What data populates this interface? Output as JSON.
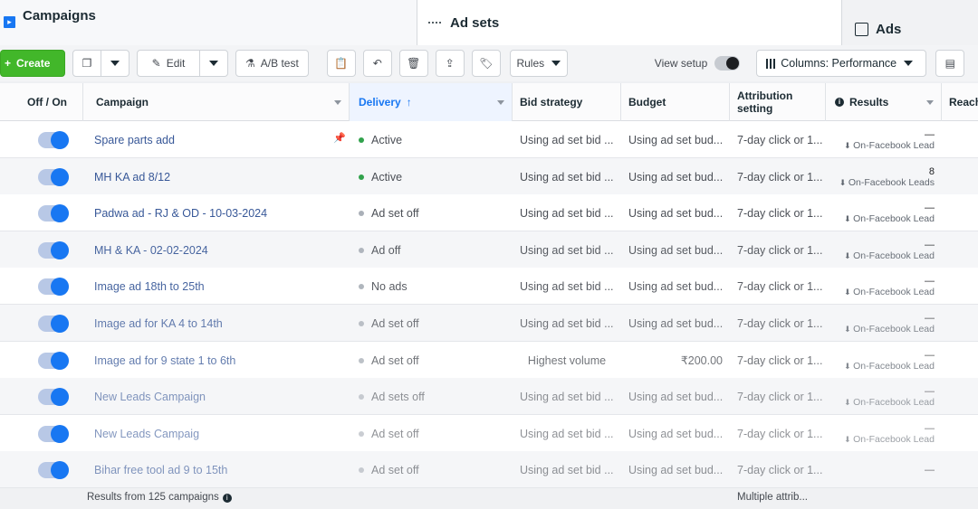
{
  "tabs": {
    "campaigns": "Campaigns",
    "adsets": "Ad sets",
    "ads": "Ads"
  },
  "toolbar": {
    "create": "Create",
    "edit": "Edit",
    "ab_test": "A/B test",
    "rules": "Rules",
    "view_setup": "View setup",
    "columns": "Columns: Performance"
  },
  "columns": {
    "off_on": "Off / On",
    "campaign": "Campaign",
    "delivery": "Delivery",
    "bid_strategy": "Bid strategy",
    "budget": "Budget",
    "attribution_l1": "Attribution",
    "attribution_l2": "setting",
    "results": "Results",
    "reach": "Reach"
  },
  "rows": [
    {
      "campaign": "Spare parts add",
      "delivery": "Active",
      "delivery_status": "active",
      "bid": "Using ad set bid ...",
      "budget": "Using ad set bud...",
      "attribution": "7-day click or 1...",
      "result_value": "—",
      "result_label": "On-Facebook Lead",
      "pinned": true
    },
    {
      "campaign": "MH KA ad 8/12",
      "delivery": "Active",
      "delivery_status": "active",
      "bid": "Using ad set bid ...",
      "budget": "Using ad set bud...",
      "attribution": "7-day click or 1...",
      "result_value": "8",
      "result_label": "On-Facebook Leads"
    },
    {
      "campaign": "Padwa ad - RJ & OD - 10-03-2024",
      "delivery": "Ad set off",
      "delivery_status": "off",
      "bid": "Using ad set bid ...",
      "budget": "Using ad set bud...",
      "attribution": "7-day click or 1...",
      "result_value": "—",
      "result_label": "On-Facebook Lead"
    },
    {
      "campaign": "MH & KA - 02-02-2024",
      "delivery": "Ad off",
      "delivery_status": "off",
      "bid": "Using ad set bid ...",
      "budget": "Using ad set bud...",
      "attribution": "7-day click or 1...",
      "result_value": "—",
      "result_label": "On-Facebook Lead"
    },
    {
      "campaign": "Image ad 18th to 25th",
      "delivery": "No ads",
      "delivery_status": "off",
      "bid": "Using ad set bid ...",
      "budget": "Using ad set bud...",
      "attribution": "7-day click or 1...",
      "result_value": "—",
      "result_label": "On-Facebook Lead"
    },
    {
      "campaign": "Image ad for KA 4 to 14th",
      "delivery": "Ad set off",
      "delivery_status": "off",
      "bid": "Using ad set bid ...",
      "budget": "Using ad set bud...",
      "attribution": "7-day click or 1...",
      "result_value": "—",
      "result_label": "On-Facebook Lead"
    },
    {
      "campaign": "Image ad for 9 state 1 to 6th",
      "delivery": "Ad set off",
      "delivery_status": "off",
      "bid": "Highest volume",
      "budget": "₹200.00",
      "attribution": "7-day click or 1...",
      "result_value": "—",
      "result_label": "On-Facebook Lead"
    },
    {
      "campaign": "New Leads Campaign",
      "delivery": "Ad sets off",
      "delivery_status": "off",
      "bid": "Using ad set bid ...",
      "budget": "Using ad set bud...",
      "attribution": "7-day click or 1...",
      "result_value": "—",
      "result_label": "On-Facebook Lead"
    },
    {
      "campaign": "New Leads Campaig",
      "delivery": "Ad set off",
      "delivery_status": "off",
      "bid": "Using ad set bid ...",
      "budget": "Using ad set bud...",
      "attribution": "7-day click or 1...",
      "result_value": "—",
      "result_label": "On-Facebook Lead"
    },
    {
      "campaign": "Bihar free tool ad 9 to 15th",
      "delivery": "Ad set off",
      "delivery_status": "off",
      "bid": "Using ad set bid ...",
      "budget": "Using ad set bud...",
      "attribution": "7-day click or 1...",
      "result_value": "—",
      "result_label": ""
    }
  ],
  "footer": {
    "summary": "Results from 125 campaigns",
    "attribution": "Multiple attrib..."
  }
}
